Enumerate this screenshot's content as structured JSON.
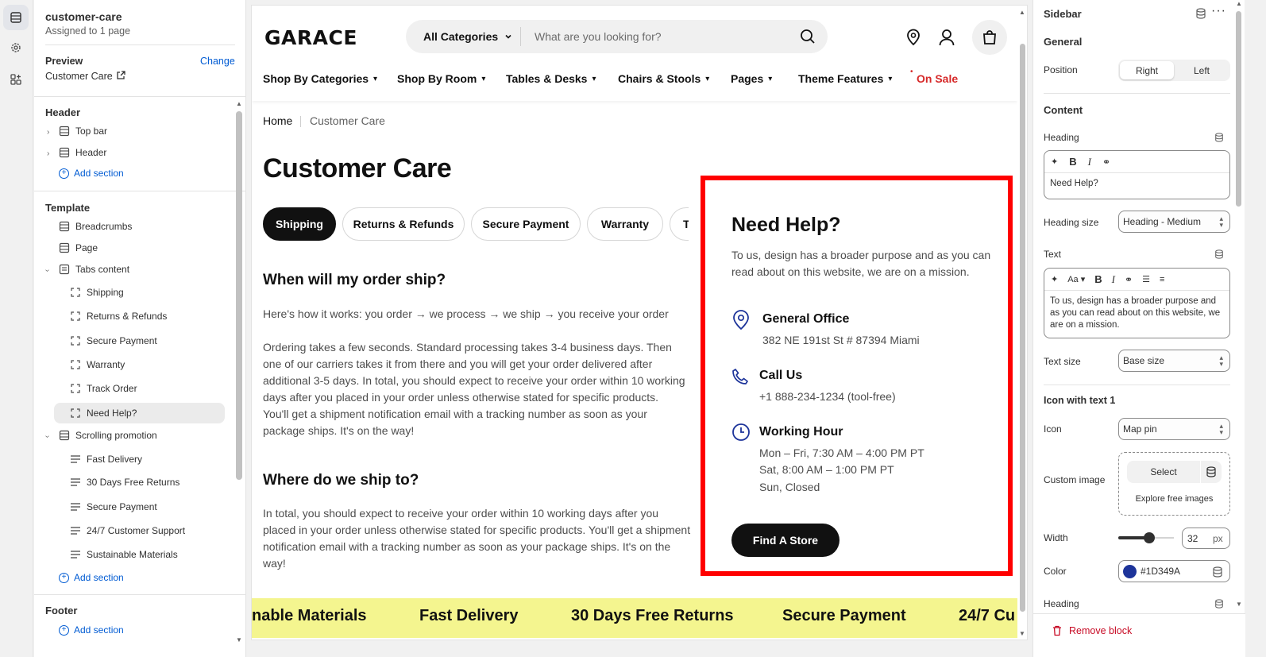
{
  "leftpanel": {
    "template_name": "customer-care",
    "assigned": "Assigned to 1 page",
    "preview_label": "Preview",
    "change_label": "Change",
    "preview_value": "Customer Care",
    "header_section": "Header",
    "header_items": [
      "Top bar",
      "Header"
    ],
    "add_section": "Add section",
    "template_section": "Template",
    "template_items": [
      "Breadcrumbs",
      "Page",
      "Tabs content"
    ],
    "tab_blocks": [
      "Shipping",
      "Returns & Refunds",
      "Secure Payment",
      "Warranty",
      "Track Order",
      "Need Help?"
    ],
    "scrolling_promotion": "Scrolling promotion",
    "promo_blocks": [
      "Fast Delivery",
      "30 Days Free Returns",
      "Secure Payment",
      "24/7 Customer Support",
      "Sustainable Materials"
    ],
    "footer_section": "Footer"
  },
  "store": {
    "logo": "GARACE",
    "category_select": "All Categories",
    "search_placeholder": "What are you looking for?",
    "nav": [
      "Shop By Categories",
      "Shop By Room",
      "Tables & Desks",
      "Chairs & Stools",
      "Pages",
      "Theme Features"
    ],
    "sale_link": "On Sale",
    "breadcrumb_home": "Home",
    "breadcrumb_current": "Customer Care",
    "page_title": "Customer Care",
    "tabs": [
      "Shipping",
      "Returns & Refunds",
      "Secure Payment",
      "Warranty",
      "T"
    ],
    "q1": "When will my order ship?",
    "p1": "Here's how it works: you order → we process → we ship → you receive your order",
    "p2": "Ordering takes a few seconds. Standard processing takes 3-4 business days. Then one of our carriers takes it from there and you will get your order delivered after additional 3-5 days. In total, you should expect to receive your order within 10 working days after you placed in your order unless otherwise stated for specific products. You'll get a shipment notification email with a tracking number as soon as your package ships. It's on the way!",
    "q2": "Where do we ship to?",
    "p3": "In total, you should expect to receive your order within 10 working days after you placed in your order unless otherwise stated for specific products. You'll get a shipment notification email with a tracking number as soon as your package ships. It's on the way!",
    "help": {
      "title": "Need Help?",
      "text": "To us, design has a broader purpose and as you can read about on this website, we are on a mission.",
      "office_title": "General Office",
      "office_text": "382 NE 191st St # 87394 Miami",
      "call_title": "Call Us",
      "call_text": "+1 888-234-1234 (tool-free)",
      "hours_title": "Working Hour",
      "hours_line1": "Mon – Fri, 7:30 AM – 4:00 PM PT",
      "hours_line2": "Sat, 8:00 AM – 1:00 PM PT",
      "hours_line3": "Sun, Closed",
      "button": "Find A Store"
    },
    "marquee": [
      "nable Materials",
      "Fast Delivery",
      "30 Days Free Returns",
      "Secure Payment",
      "24/7 Cu"
    ]
  },
  "rightpanel": {
    "title": "Sidebar",
    "general": "General",
    "position_label": "Position",
    "position_options": [
      "Right",
      "Left"
    ],
    "content": "Content",
    "heading_label": "Heading",
    "heading_value": "Need Help?",
    "heading_size_label": "Heading size",
    "heading_size_value": "Heading - Medium",
    "text_label": "Text",
    "text_value": "To us, design has a broader purpose and as you can read about on this website, we are on a mission.",
    "text_size_label": "Text size",
    "text_size_value": "Base size",
    "icon_block": "Icon with text 1",
    "icon_label": "Icon",
    "icon_value": "Map pin",
    "custom_image_label": "Custom image",
    "select_label": "Select",
    "explore_label": "Explore free images",
    "width_label": "Width",
    "width_value": "32",
    "width_unit": "px",
    "color_label": "Color",
    "color_value": "#1D349A",
    "heading2_label": "Heading",
    "remove_block": "Remove block"
  },
  "colors": {
    "accent_blue": "#005bd3",
    "sale_red": "#d62828",
    "highlight_red": "#ff0000",
    "marquee_yellow": "#f4f58f",
    "icon_color": "#1D349A"
  }
}
